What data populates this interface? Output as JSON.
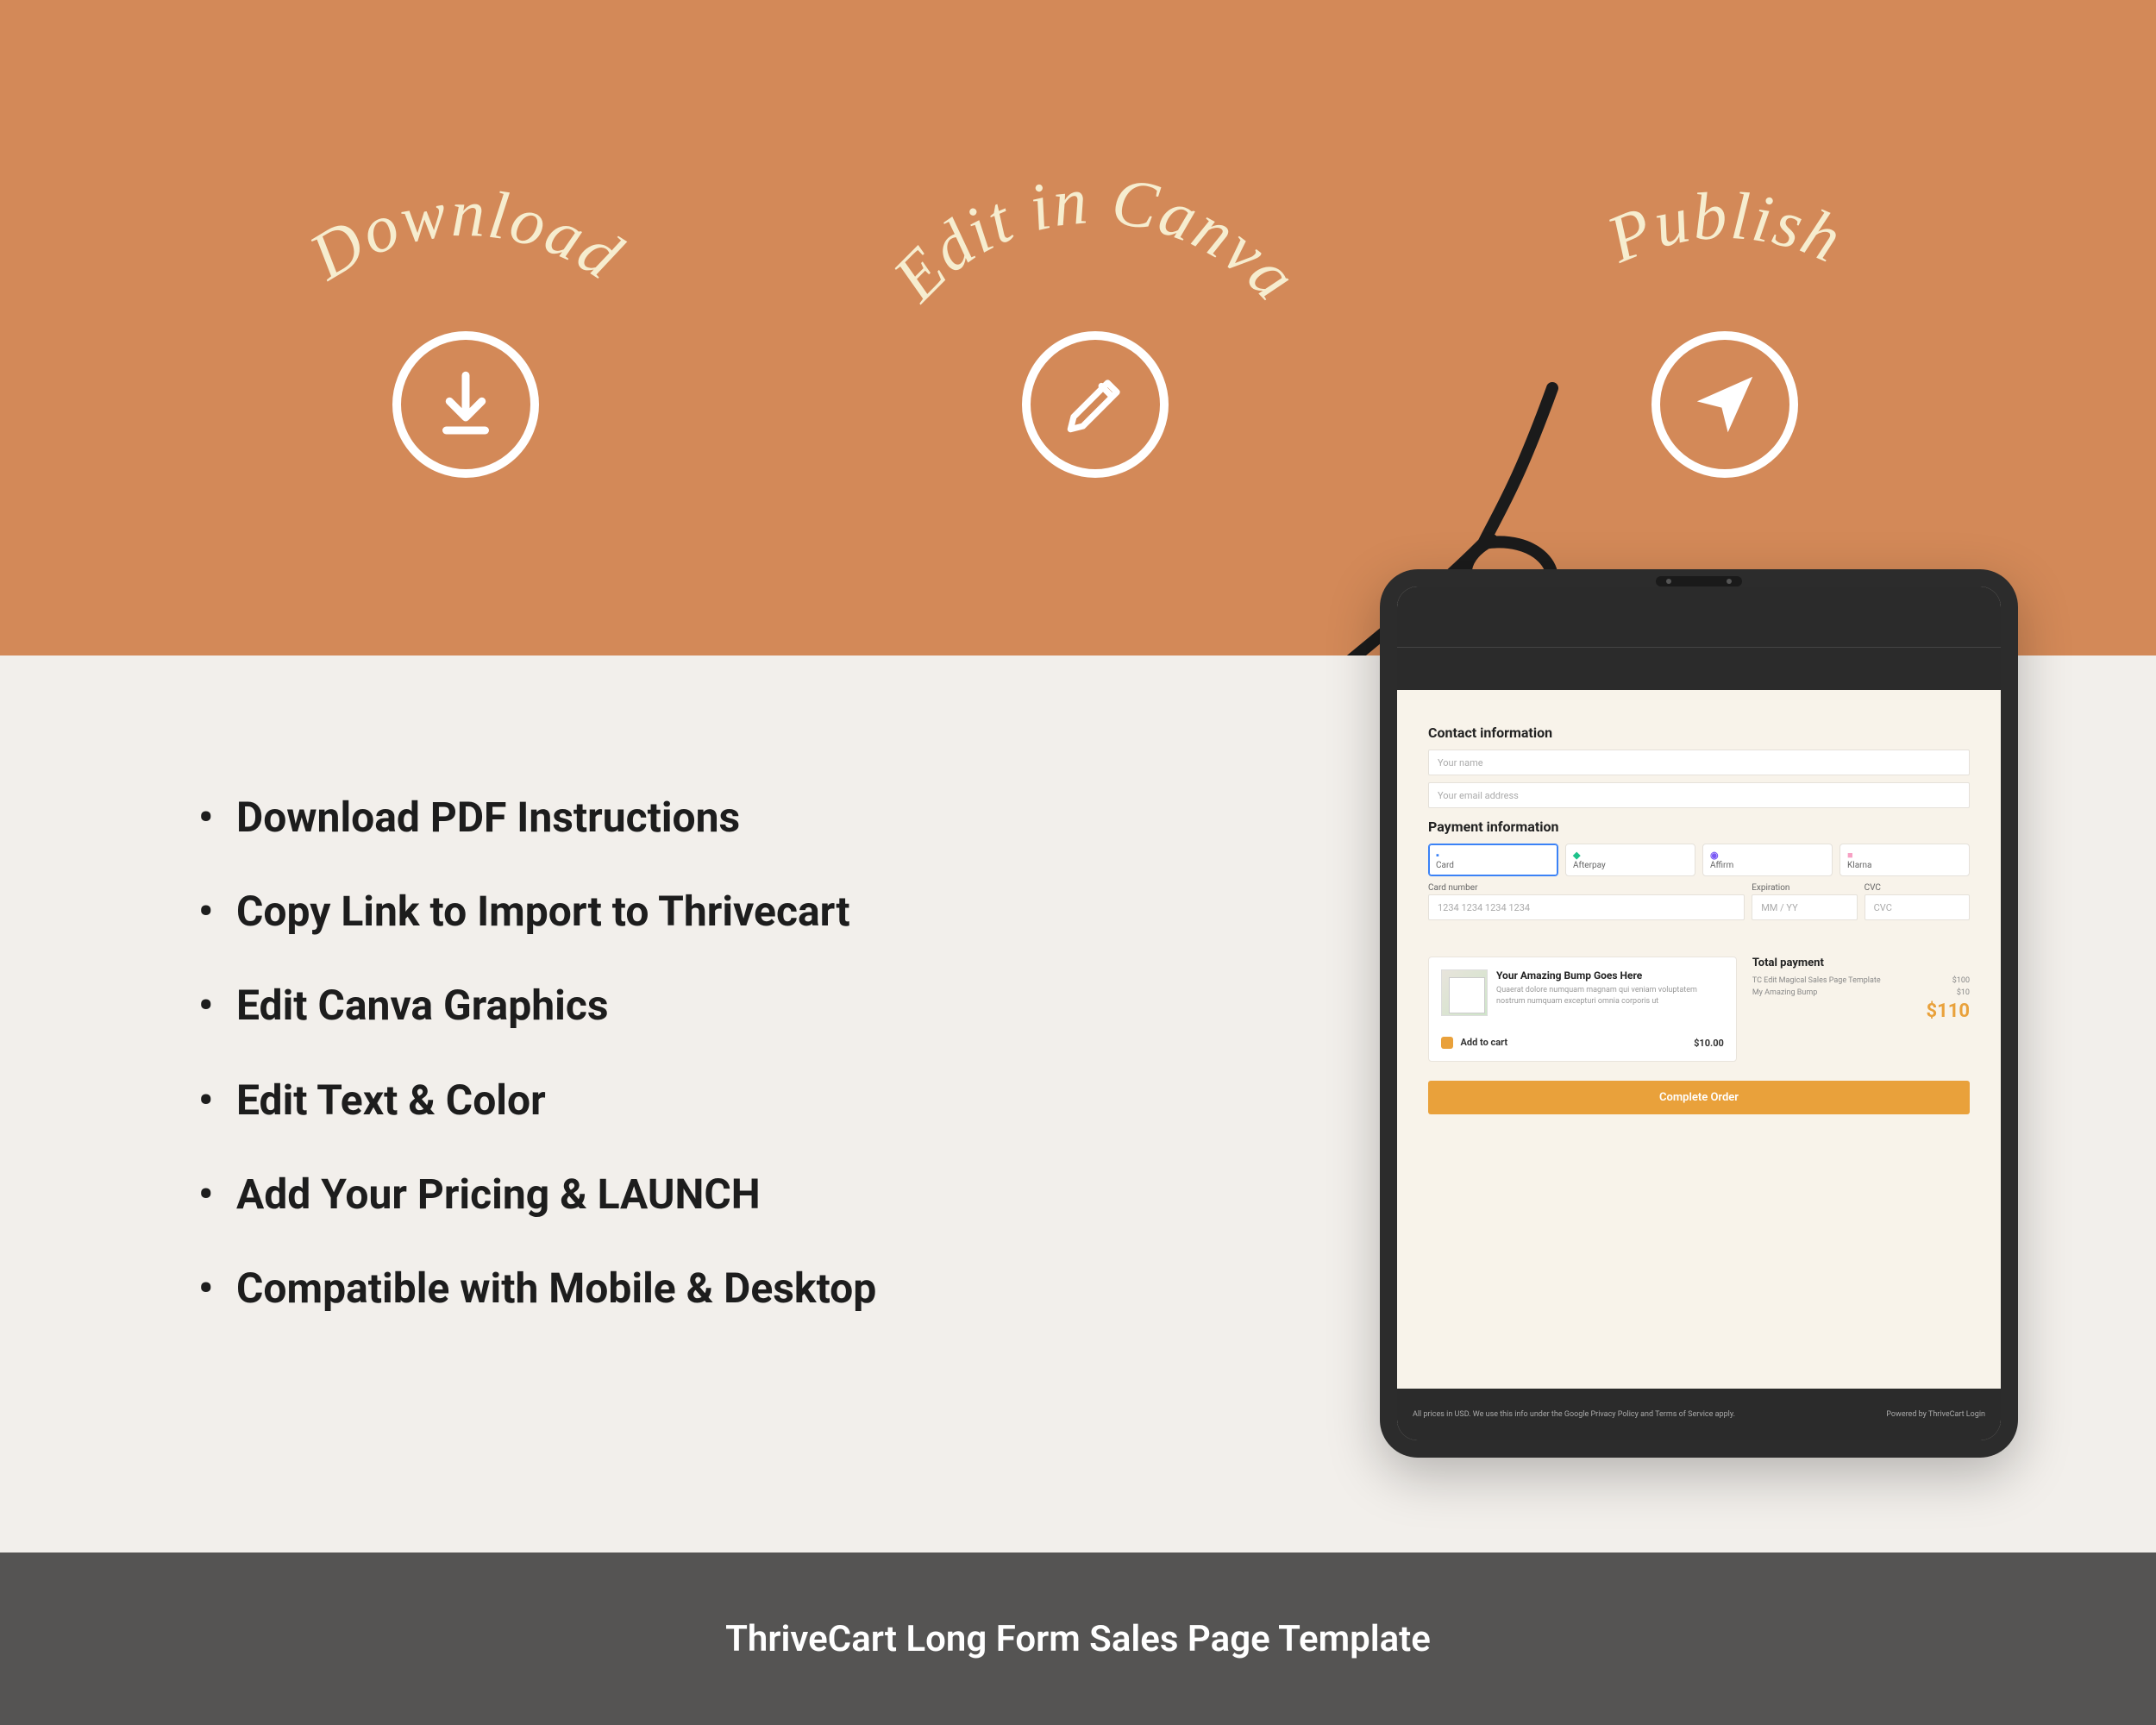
{
  "steps": {
    "download": "Download",
    "edit": "Edit in Canva",
    "publish": "Publish"
  },
  "icons": {
    "download": "download-icon",
    "edit": "pencil-icon",
    "publish": "paper-plane-icon"
  },
  "bullets": [
    "Download PDF Instructions",
    "Copy Link to Import to Thrivecart",
    "Edit Canva Graphics",
    "Edit Text & Color",
    "Add Your Pricing & LAUNCH",
    "Compatible with Mobile & Desktop"
  ],
  "checkout": {
    "contact_title": "Contact information",
    "name_placeholder": "Your name",
    "email_placeholder": "Your email address",
    "payment_title": "Payment information",
    "tabs": {
      "card": "Card",
      "afterpay": "Afterpay",
      "affirm": "Affirm",
      "klarna": "Klarna"
    },
    "card_number_label": "Card number",
    "card_number_placeholder": "1234 1234 1234 1234",
    "expiration_label": "Expiration",
    "expiration_placeholder": "MM / YY",
    "cvc_label": "CVC",
    "cvc_placeholder": "CVC",
    "bump_title": "Your Amazing Bump Goes Here",
    "bump_desc": "Quaerat dolore numquam magnam qui veniam voluptatem nostrum numquam excepturi omnia corporis ut",
    "bump_add": "Add to cart",
    "bump_price": "$10.00",
    "total_title": "Total payment",
    "line1_label": "TC Edit Magical Sales Page Template",
    "line1_price": "$100",
    "line2_label": "My Amazing Bump",
    "line2_price": "$10",
    "grand_total": "$110",
    "complete": "Complete Order",
    "footer_left": "All prices in USD. We use this info under the Google Privacy Policy and Terms of Service apply.",
    "footer_right": "Powered by ThriveCart   Login"
  },
  "footer_title": "ThriveCart Long Form Sales Page Template"
}
